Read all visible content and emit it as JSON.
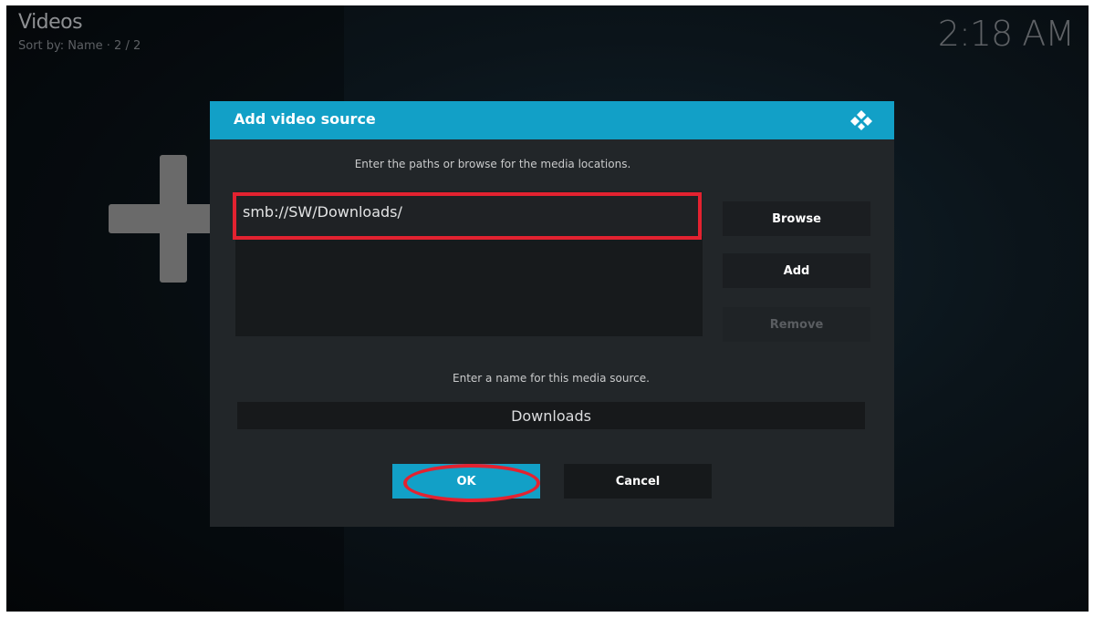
{
  "header": {
    "title": "Videos",
    "sort_info": "Sort by: Name  ·  2 / 2"
  },
  "clock": "2:18 AM",
  "background": {
    "add_icon": "plus-icon"
  },
  "dialog": {
    "title": "Add video source",
    "logo_icon": "kodi-logo-icon",
    "paths_instruction": "Enter the paths or browse for the media locations.",
    "paths": [
      "smb://SW/Downloads/"
    ],
    "buttons": {
      "browse": "Browse",
      "add": "Add",
      "remove": "Remove"
    },
    "name_instruction": "Enter a name for this media source.",
    "name_value": "Downloads",
    "ok_label": "OK",
    "cancel_label": "Cancel"
  },
  "colors": {
    "accent": "#12a0c7",
    "annotation_red": "#e32230",
    "dialog_bg": "#222629"
  }
}
